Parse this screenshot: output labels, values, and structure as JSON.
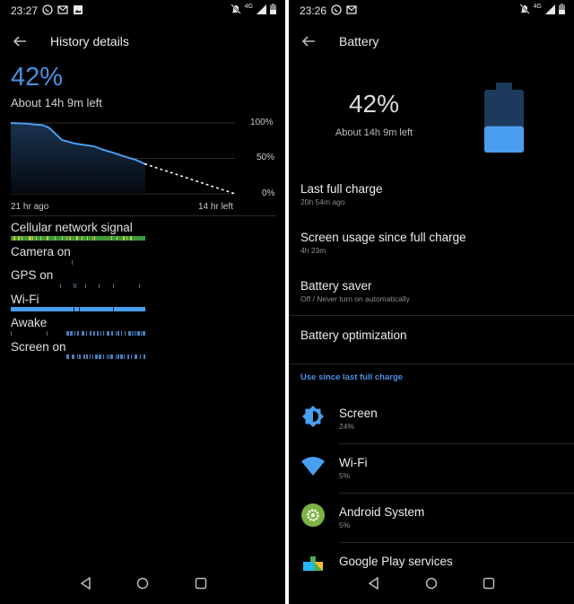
{
  "left": {
    "status": {
      "time": "23:27",
      "notification_icons": [
        "whatsapp-icon",
        "gmail-icon",
        "image-icon"
      ],
      "right_icons": [
        "mute-icon",
        "4g-signal-icon",
        "battery-icon"
      ],
      "network": "4G"
    },
    "header": {
      "title": "History details"
    },
    "battery": {
      "percent": "42%",
      "remaining": "About 14h 9m left"
    },
    "chart_data": {
      "type": "line",
      "title": "",
      "xlabel": "",
      "ylabel": "",
      "x_tick_labels": [
        "21 hr ago",
        "14 hr left"
      ],
      "y_tick_labels": [
        "100%",
        "50%",
        "0%"
      ],
      "ylim": [
        0,
        100
      ],
      "series": [
        {
          "name": "Battery level (actual)",
          "x_hours": [
            -21,
            -18.5,
            -17.5,
            -16,
            -15,
            -13,
            -11,
            -8,
            -6.5,
            -5,
            -3,
            -1.5,
            0
          ],
          "values": [
            100,
            99,
            98,
            97,
            93,
            76,
            71,
            67,
            62,
            58,
            52,
            48,
            42
          ]
        },
        {
          "name": "Battery level (predicted)",
          "style": "dotted",
          "x_hours": [
            0,
            14
          ],
          "values": [
            42,
            0
          ]
        }
      ]
    },
    "rows": [
      {
        "label": "Cellular network signal",
        "type": "signal",
        "color": "#3c9a3c"
      },
      {
        "label": "Camera on",
        "type": "ticks",
        "color": "#4a90e2"
      },
      {
        "label": "GPS on",
        "type": "ticks",
        "color": "#4a90e2"
      },
      {
        "label": "Wi-Fi",
        "type": "solid",
        "color": "#4a9eef"
      },
      {
        "label": "Awake",
        "type": "ticks",
        "color": "#4a90e2"
      },
      {
        "label": "Screen on",
        "type": "ticks",
        "color": "#4a90e2"
      }
    ]
  },
  "right": {
    "status": {
      "time": "23:26",
      "notification_icons": [
        "whatsapp-icon",
        "gmail-icon"
      ],
      "right_icons": [
        "mute-icon",
        "4g-signal-icon",
        "battery-icon"
      ],
      "network": "4G"
    },
    "header": {
      "title": "Battery"
    },
    "battery": {
      "percent": "42%",
      "remaining": "About 14h 9m left",
      "level": 0.42
    },
    "items": [
      {
        "title": "Last full charge",
        "subtitle": "20h 54m ago"
      },
      {
        "title": "Screen usage since full charge",
        "subtitle": "4h 23m"
      },
      {
        "title": "Battery saver",
        "subtitle": "Off / Never turn on automatically"
      },
      {
        "title": "Battery optimization",
        "subtitle": ""
      }
    ],
    "section_header": "Use since last full charge",
    "usage": [
      {
        "name": "Screen",
        "percent": "24%",
        "icon": "brightness-icon"
      },
      {
        "name": "Wi-Fi",
        "percent": "5%",
        "icon": "wifi-icon"
      },
      {
        "name": "Android System",
        "percent": "5%",
        "icon": "android-system-gear-icon"
      },
      {
        "name": "Google Play services",
        "percent": "",
        "icon": "google-play-services-icon"
      }
    ]
  },
  "colors": {
    "accent": "#4a90e2",
    "battery_fill": "#4a9eef",
    "battery_empty": "#1b3a5c",
    "background": "#000000"
  }
}
